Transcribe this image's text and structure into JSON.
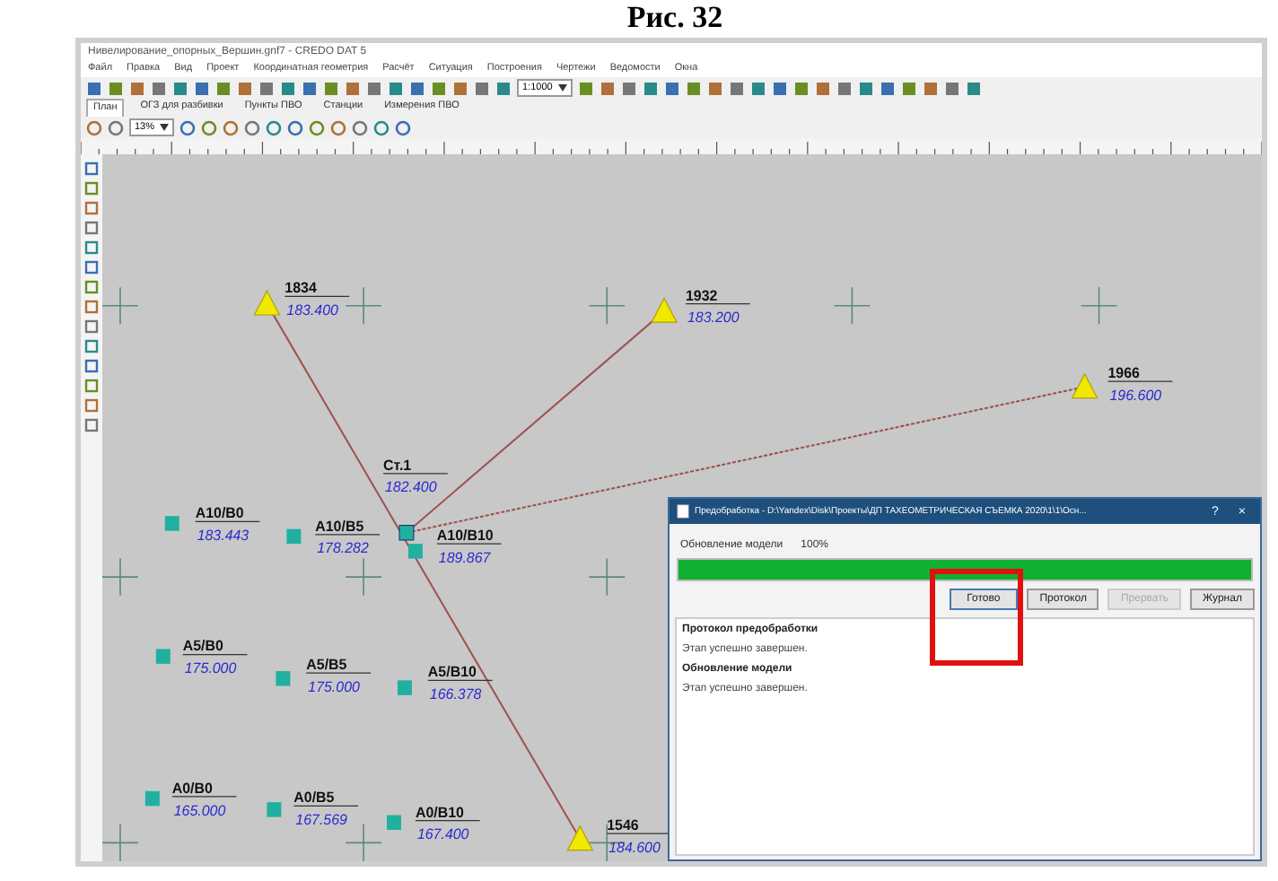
{
  "caption": "Рис. 32",
  "window": {
    "title": "Нивелирование_опорных_Вершин.gnf7 - CREDO DAT 5"
  },
  "menu": [
    "Файл",
    "Правка",
    "Вид",
    "Проект",
    "Координатная геометрия",
    "Расчёт",
    "Ситуация",
    "Построения",
    "Чертежи",
    "Ведомости",
    "Окна"
  ],
  "tabs": [
    {
      "label": "План",
      "selected": true
    },
    {
      "label": "ОГЗ для разбивки",
      "selected": false
    },
    {
      "label": "Пункты ПВО",
      "selected": false
    },
    {
      "label": "Станции",
      "selected": false
    },
    {
      "label": "Измерения ПВО",
      "selected": false
    }
  ],
  "scale_field": {
    "value": "1:1000"
  },
  "zoom_field": {
    "value": "13%"
  },
  "canvas": {
    "points": [
      {
        "kind": "triangle",
        "name": "1834",
        "elevation": "183.400"
      },
      {
        "kind": "triangle",
        "name": "1932",
        "elevation": "183.200"
      },
      {
        "kind": "triangle",
        "name": "1966",
        "elevation": "196.600"
      },
      {
        "kind": "station",
        "name": "Ст.1",
        "elevation": "182.400"
      },
      {
        "kind": "square",
        "name": "А10/В0",
        "elevation": "183.443"
      },
      {
        "kind": "square",
        "name": "А10/В5",
        "elevation": "178.282"
      },
      {
        "kind": "square",
        "name": "А10/В10",
        "elevation": "189.867"
      },
      {
        "kind": "square",
        "name": "А5/В0",
        "elevation": "175.000"
      },
      {
        "kind": "square",
        "name": "А5/В5",
        "elevation": "175.000"
      },
      {
        "kind": "square",
        "name": "А5/В10",
        "elevation": "166.378"
      },
      {
        "kind": "square",
        "name": "А0/В0",
        "elevation": "165.000"
      },
      {
        "kind": "square",
        "name": "А0/В5",
        "elevation": "167.569"
      },
      {
        "kind": "square",
        "name": "А0/В10",
        "elevation": "167.400"
      },
      {
        "kind": "triangle",
        "name": "1546",
        "elevation": "184.600"
      }
    ]
  },
  "dialog": {
    "title": "Предобработка - D:\\Yandex\\Disk\\Проекты\\ДП ТАХЕОМЕТРИЧЕСКАЯ СЪЕМКА 2020\\1\\1\\Осн...",
    "help": "?",
    "close": "×",
    "progress_label": "Обновление модели",
    "percent": "100%",
    "level": 1,
    "buttons": [
      {
        "label": "Готово",
        "disabled": false
      },
      {
        "label": "Протокол",
        "disabled": false
      },
      {
        "label": "Прервать",
        "disabled": true
      },
      {
        "label": "Журнал",
        "disabled": false
      }
    ],
    "log": [
      {
        "kind": "heading",
        "text": "Протокол предобработки"
      },
      {
        "kind": "line",
        "text": "Этап успешно завершен."
      },
      {
        "kind": "heading",
        "text": "Обновление модели"
      },
      {
        "kind": "line",
        "text": "Этап успешно завершен."
      }
    ]
  }
}
